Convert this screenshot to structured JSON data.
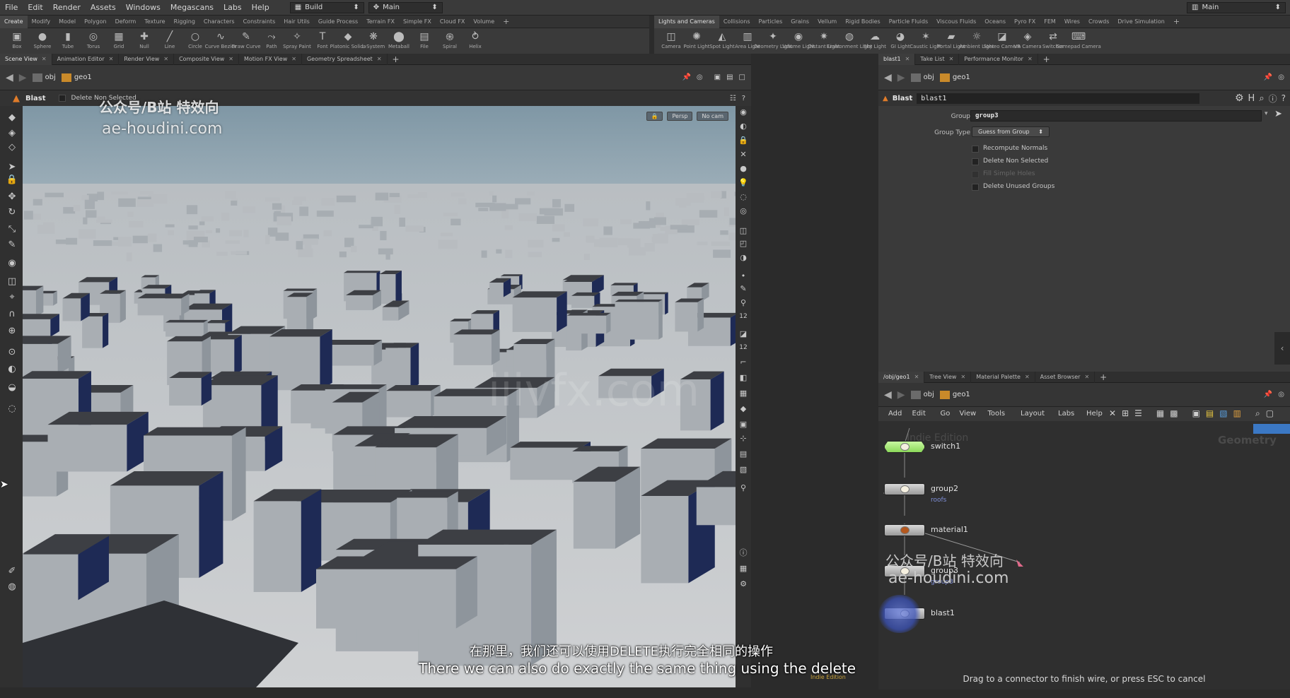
{
  "menubar": {
    "items": [
      "File",
      "Edit",
      "Render",
      "Assets",
      "Windows",
      "Megascans",
      "Labs",
      "Help"
    ],
    "desktop_label": "Build",
    "workspace_label": "Main",
    "right_workspace_label": "Main"
  },
  "shelf_left": {
    "tabs": [
      "Create",
      "Modify",
      "Model",
      "Polygon",
      "Deform",
      "Texture",
      "Rigging",
      "Characters",
      "Constraints",
      "Hair Utils",
      "Guide Process",
      "Terrain FX",
      "Simple FX",
      "Cloud FX",
      "Volume"
    ],
    "tools": [
      {
        "label": "Box",
        "icon": "box-icon"
      },
      {
        "label": "Sphere",
        "icon": "sphere-icon"
      },
      {
        "label": "Tube",
        "icon": "tube-icon"
      },
      {
        "label": "Torus",
        "icon": "torus-icon"
      },
      {
        "label": "Grid",
        "icon": "grid-icon"
      },
      {
        "label": "Null",
        "icon": "null-icon"
      },
      {
        "label": "Line",
        "icon": "line-icon"
      },
      {
        "label": "Circle",
        "icon": "circle-icon"
      },
      {
        "label": "Curve Bezier",
        "icon": "curve-bezier-icon"
      },
      {
        "label": "Draw Curve",
        "icon": "draw-curve-icon"
      },
      {
        "label": "Path",
        "icon": "path-icon"
      },
      {
        "label": "Spray Paint",
        "icon": "spray-paint-icon"
      },
      {
        "label": "Font",
        "icon": "font-icon"
      },
      {
        "label": "Platonic Solids",
        "icon": "platonic-icon"
      },
      {
        "label": "L-System",
        "icon": "lsystem-icon"
      },
      {
        "label": "Metaball",
        "icon": "metaball-icon"
      },
      {
        "label": "File",
        "icon": "file-icon"
      },
      {
        "label": "Spiral",
        "icon": "spiral-icon"
      },
      {
        "label": "Helix",
        "icon": "helix-icon"
      }
    ]
  },
  "shelf_right": {
    "tabs": [
      "Lights and Cameras",
      "Collisions",
      "Particles",
      "Grains",
      "Vellum",
      "Rigid Bodies",
      "Particle Fluids",
      "Viscous Fluids",
      "Oceans",
      "Pyro FX",
      "FEM",
      "Wires",
      "Crowds",
      "Drive Simulation"
    ],
    "tools": [
      {
        "label": "Camera",
        "icon": "camera-icon"
      },
      {
        "label": "Point Light",
        "icon": "point-light-icon"
      },
      {
        "label": "Spot Light",
        "icon": "spot-light-icon"
      },
      {
        "label": "Area Light",
        "icon": "area-light-icon"
      },
      {
        "label": "Geometry Light",
        "icon": "geometry-light-icon"
      },
      {
        "label": "Volume Light",
        "icon": "volume-light-icon"
      },
      {
        "label": "Distant Light",
        "icon": "distant-light-icon"
      },
      {
        "label": "Environment Light",
        "icon": "environment-light-icon"
      },
      {
        "label": "Sky Light",
        "icon": "sky-light-icon"
      },
      {
        "label": "GI Light",
        "icon": "gi-light-icon"
      },
      {
        "label": "Caustic Light",
        "icon": "caustic-light-icon"
      },
      {
        "label": "Portal Light",
        "icon": "portal-light-icon"
      },
      {
        "label": "Ambient Light",
        "icon": "ambient-light-icon"
      },
      {
        "label": "Stereo Camera",
        "icon": "stereo-camera-icon"
      },
      {
        "label": "VR Camera",
        "icon": "vr-camera-icon"
      },
      {
        "label": "Switcher",
        "icon": "switcher-icon"
      },
      {
        "label": "Gamepad Camera",
        "icon": "gamepad-camera-icon"
      }
    ]
  },
  "left_pane_tabs": [
    "Scene View",
    "Animation Editor",
    "Render View",
    "Composite View",
    "Motion FX View",
    "Geometry Spreadsheet"
  ],
  "right_top_tabs": [
    "blast1",
    "Take List",
    "Performance Monitor"
  ],
  "right_bottom_tabs": [
    "/obj/geo1",
    "Tree View",
    "Material Palette",
    "Asset Browser"
  ],
  "paths": {
    "obj": "obj",
    "geo": "geo1"
  },
  "viewport": {
    "tool_name": "Blast",
    "tool_option": "Delete Non Selected",
    "persp_label": "Persp",
    "cam_label": "No cam",
    "num_label_1": "12",
    "num_label_2": "12"
  },
  "params": {
    "node_type": "Blast",
    "node_name": "blast1",
    "group_label": "Group",
    "group_value": "group3",
    "group_type_label": "Group Type",
    "group_type_value": "Guess from Group",
    "checkboxes": [
      {
        "label": "Recompute Normals",
        "enabled": true
      },
      {
        "label": "Delete Non Selected",
        "enabled": true
      },
      {
        "label": "Fill Simple Holes",
        "enabled": false
      },
      {
        "label": "Delete Unused Groups",
        "enabled": true
      }
    ]
  },
  "network": {
    "menu": [
      "Add",
      "Edit",
      "Go",
      "View",
      "Tools",
      "Layout",
      "Labs",
      "Help"
    ],
    "edition_watermark": "Indie Edition",
    "context_label": "Geometry",
    "nodes": [
      {
        "name": "switch1",
        "sub": ""
      },
      {
        "name": "group2",
        "sub": "roofs"
      },
      {
        "name": "material1",
        "sub": ""
      },
      {
        "name": "group3",
        "sub": "group3"
      },
      {
        "name": "blast1",
        "sub": ""
      }
    ],
    "status": "Drag to a connector to finish wire, or press ESC to cancel"
  },
  "overlays": {
    "wm_cn": "公众号/B站 特效向",
    "wm_url": "ae-houdini.com",
    "center_wm": "iiivfx.com",
    "subtitle_cn": "在那里，我们还可以使用DELETE执行完全相同的操作",
    "subtitle_en": "There we can also do exactly the same thing using the delete",
    "indie_label": "Indie Edition"
  },
  "colors": {
    "sky_top": "#7f97a5",
    "ground": "#c6c9cc",
    "building_light": "#a9aeb3",
    "building_dark": "#1e2a55",
    "roof": "#3d3f44",
    "switch_node": "#a6f07a"
  }
}
